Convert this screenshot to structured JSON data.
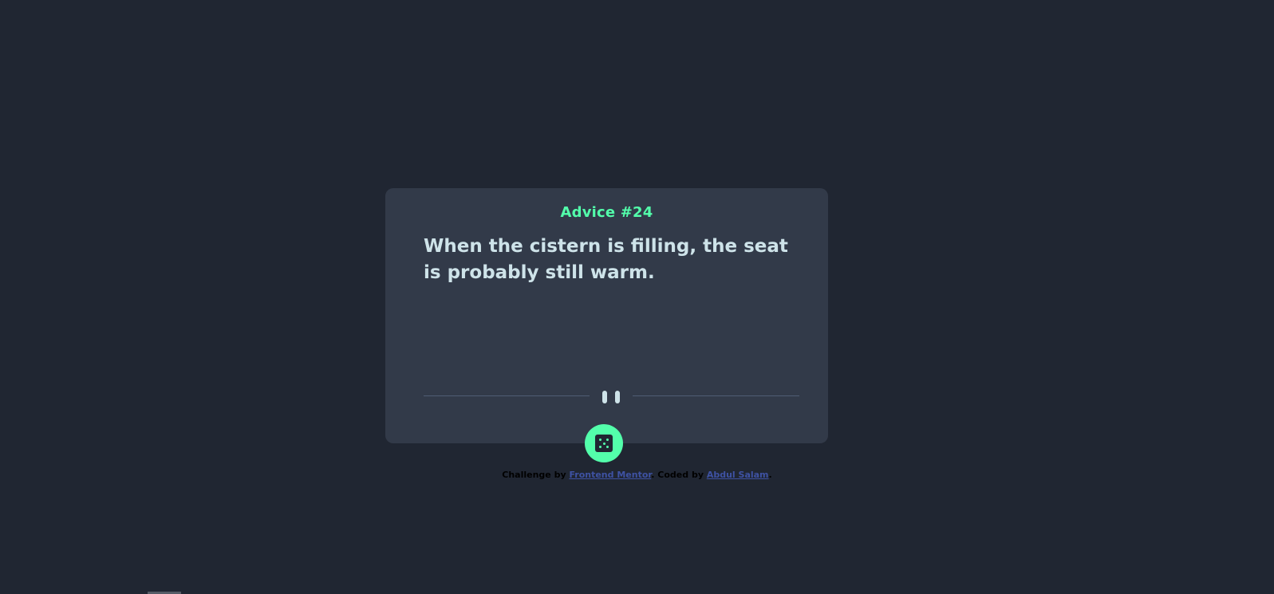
{
  "advice": {
    "heading": "Advice #24",
    "text": "When the cistern is filling, the seat is probably still warm."
  },
  "divider": {
    "icon": "pause-icon"
  },
  "dice_button": {
    "icon": "dice-icon"
  },
  "attribution": {
    "prefix": "Challenge by ",
    "link1": "Frontend Mentor",
    "middle": ". Coded by ",
    "link2": "Abdul Salam",
    "suffix": "."
  },
  "colors": {
    "background": "#202632",
    "card": "#323a49",
    "accent": "#53ffab",
    "text": "#cee3e9",
    "divider": "#4f5d74",
    "link": "#3e52a3"
  }
}
